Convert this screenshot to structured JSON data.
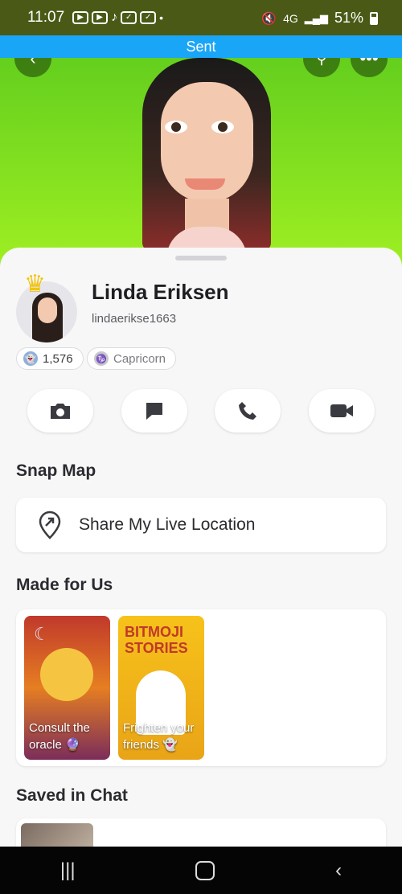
{
  "status_bar": {
    "time": "11:07",
    "battery": "51%",
    "network": "4G"
  },
  "banner": {
    "text": "Sent",
    "color": "#1aa6f7"
  },
  "profile": {
    "name": "Linda Eriksen",
    "username": "lindaerikse1663",
    "snap_score": "1,576",
    "zodiac": "Capricorn"
  },
  "sections": {
    "snap_map": "Snap Map",
    "made_for_us": "Made for Us",
    "saved_in_chat": "Saved in Chat"
  },
  "location": {
    "label": "Share My Live Location"
  },
  "made_tiles": [
    {
      "caption": "Consult the oracle 🔮"
    },
    {
      "caption": "Frighten your friends 👻"
    }
  ],
  "actions": [
    "camera-icon",
    "chat-icon",
    "phone-icon",
    "video-icon"
  ],
  "colors": {
    "hero_green": "#9fef22",
    "sheet_bg": "#f7f7f8"
  }
}
